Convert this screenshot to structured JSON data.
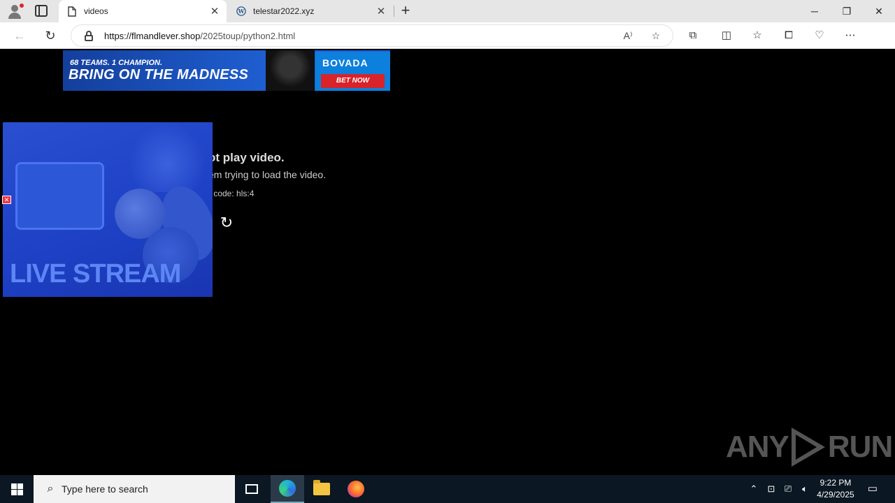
{
  "browser": {
    "tabs": [
      {
        "title": "videos",
        "icon": "page-icon",
        "active": true
      },
      {
        "title": "telestar2022.xyz",
        "icon": "wordpress-icon",
        "active": false
      }
    ],
    "url_host": "https://flmandlever.shop",
    "url_path": "/2025toup/python2.html"
  },
  "ad": {
    "line1": "68 TEAMS. 1 CHAMPION.",
    "line2": "BRING ON THE MADNESS",
    "brand": "BOVADA",
    "cta": "BET NOW"
  },
  "video_error": {
    "heading": "ot play video.",
    "message": "em trying to load the video.",
    "code": "r code: hls:4"
  },
  "popup": {
    "label": "LIVE STREAM"
  },
  "watermark": {
    "left": "ANY",
    "right": "RUN"
  },
  "taskbar": {
    "search_placeholder": "Type here to search",
    "time": "9:22 PM",
    "date": "4/29/2025"
  },
  "colors": {
    "ad_blue": "#1a5fd6",
    "bet_red": "#d8232a",
    "popup_blue": "#2a4fd0"
  }
}
